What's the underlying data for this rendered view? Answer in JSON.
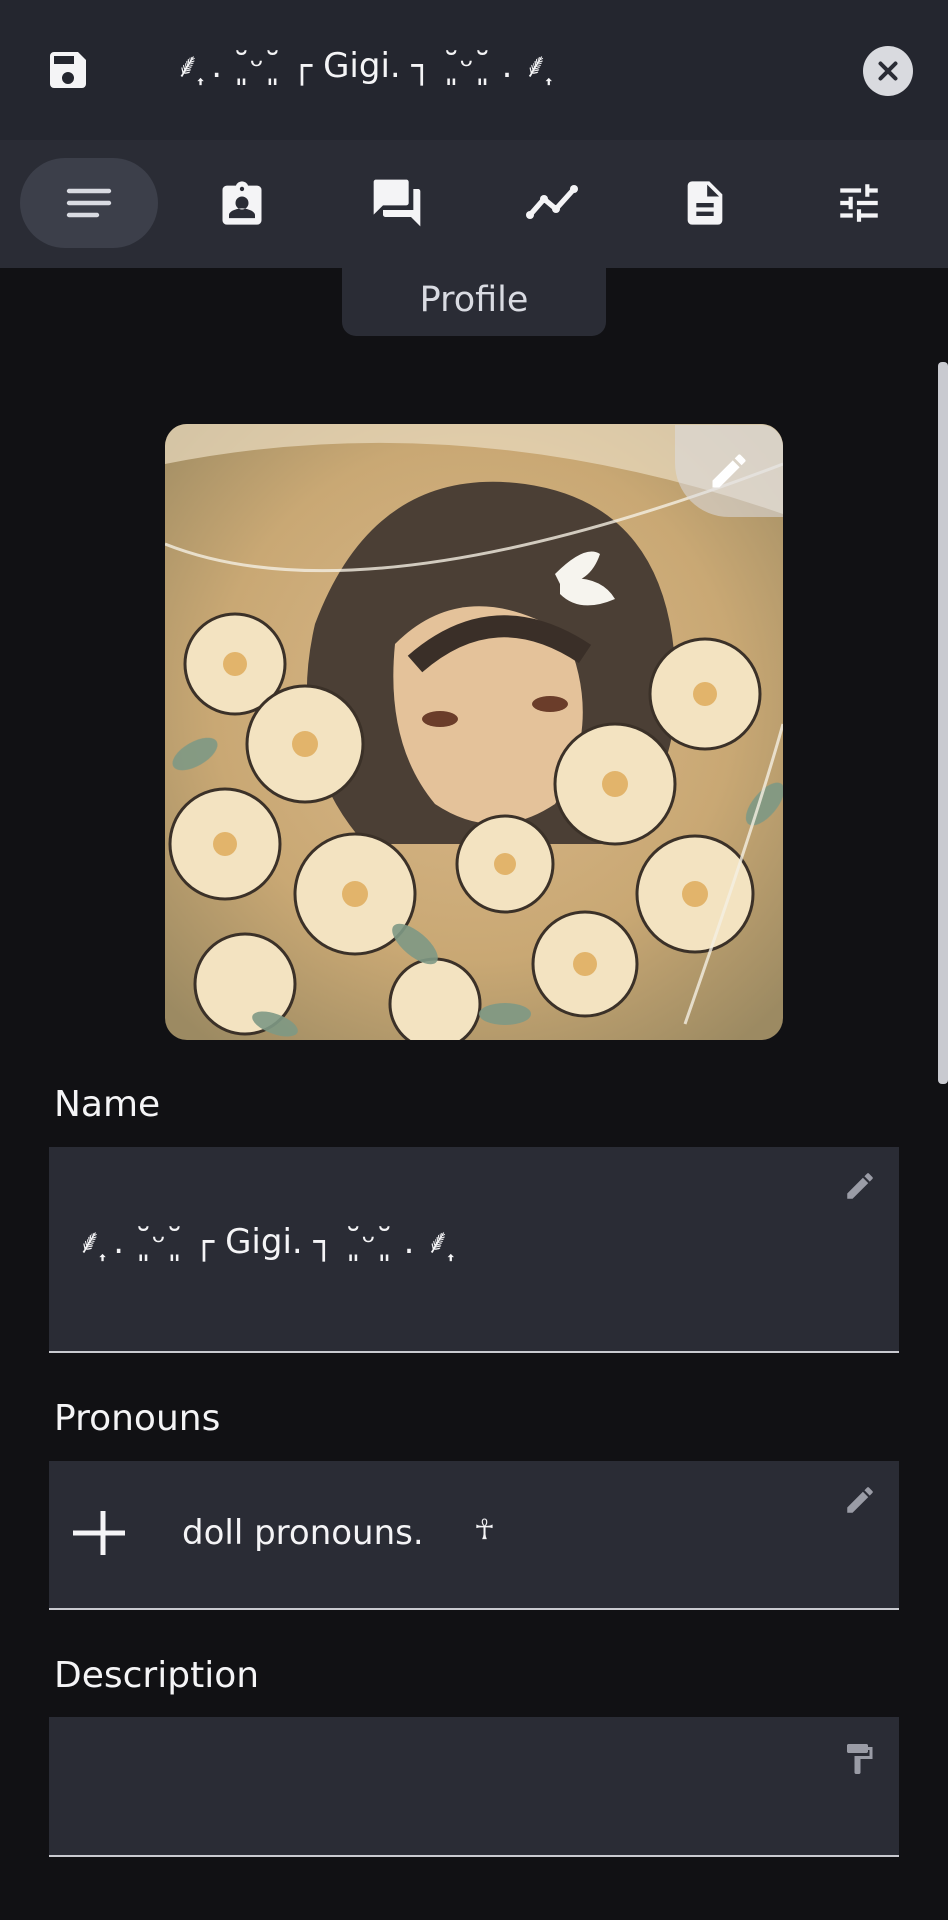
{
  "header": {
    "title": "⸙͎ . ˘͈ᵕ˘͈ ┌ Gigi. ┐ ˘͈ᵕ˘͈ . ⸙͎"
  },
  "tabs": [
    {
      "icon": "lines-icon",
      "active": true
    },
    {
      "icon": "contact-badge-icon",
      "active": false
    },
    {
      "icon": "chat-bubbles-icon",
      "active": false
    },
    {
      "icon": "trend-line-icon",
      "active": false
    },
    {
      "icon": "document-icon",
      "active": false
    },
    {
      "icon": "sliders-icon",
      "active": false
    }
  ],
  "tooltip": {
    "label": "Profile"
  },
  "form": {
    "name": {
      "label": "Name",
      "value": "⸙͎ . ˘͈ᵕ˘͈ ┌ Gigi. ┐ ˘͈ᵕ˘͈ . ⸙͎"
    },
    "pronouns": {
      "label": "Pronouns",
      "value": "doll pronouns.",
      "symbol": "☥"
    },
    "description": {
      "label": "Description",
      "value": ""
    }
  },
  "colors": {
    "background": "#111114",
    "header": "#24262f",
    "field": "#2a2c35",
    "text": "#f4f4f6"
  }
}
